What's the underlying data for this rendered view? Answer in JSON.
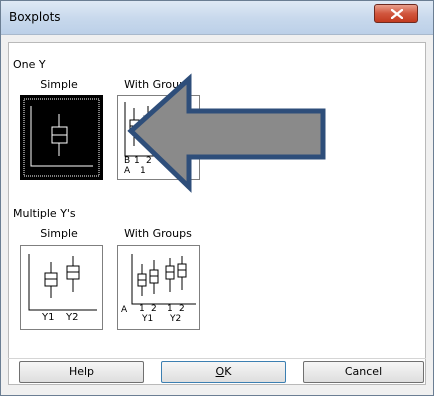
{
  "window": {
    "title": "Boxplots",
    "close_glyph": "X"
  },
  "sections": {
    "one_y": {
      "label": "One Y",
      "options": [
        {
          "caption": "Simple",
          "icon": "boxplot-simple-one-y-icon",
          "selected": true
        },
        {
          "caption": "With Groups",
          "icon": "boxplot-groups-one-y-icon",
          "selected": false,
          "axis_labels": {
            "row1": [
              "B",
              "1",
              "2"
            ],
            "row2": [
              "A",
              "1"
            ]
          }
        }
      ]
    },
    "multiple_y": {
      "label": "Multiple Y's",
      "options": [
        {
          "caption": "Simple",
          "icon": "boxplot-simple-multi-y-icon",
          "axis_labels": [
            "Y1",
            "Y2"
          ]
        },
        {
          "caption": "With Groups",
          "icon": "boxplot-groups-multi-y-icon",
          "axis_labels": {
            "a": "A",
            "row1": [
              "1",
              "2",
              "1",
              "2"
            ],
            "row2": [
              "Y1",
              "Y2"
            ]
          }
        }
      ]
    }
  },
  "buttons": {
    "help": "Help",
    "ok": "OK",
    "ok_mnemonic": "O",
    "ok_rest": "K",
    "cancel": "Cancel"
  },
  "overlay": {
    "icon": "left-arrow-annotation",
    "fill_color": "#8a8a8a",
    "stroke_color": "#2e4e7a"
  }
}
